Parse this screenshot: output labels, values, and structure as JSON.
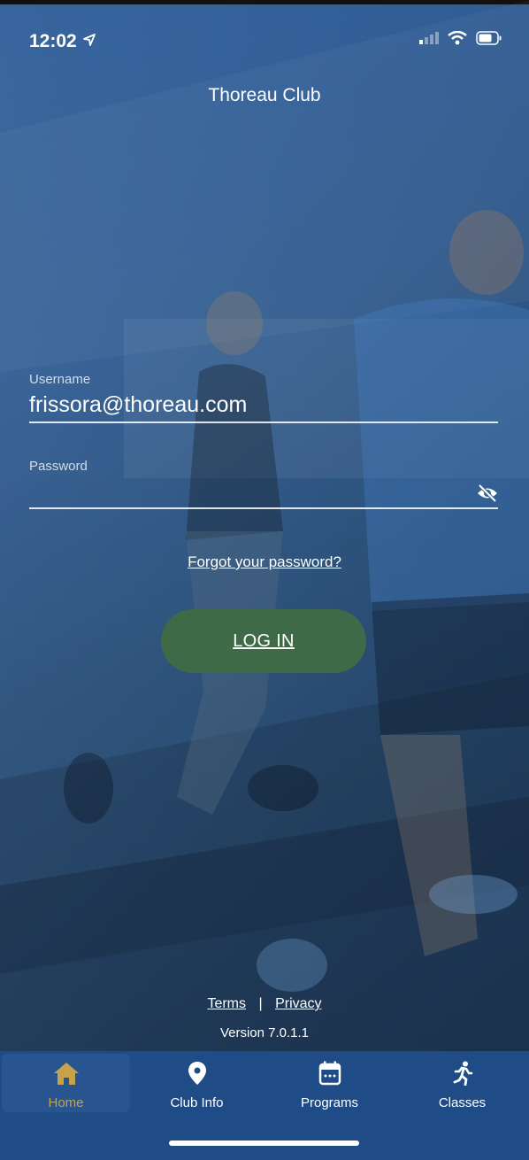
{
  "status_bar": {
    "time": "12:02"
  },
  "header": {
    "title": "Thoreau Club"
  },
  "login_form": {
    "username_label": "Username",
    "username_value": "frissora@thoreau.com",
    "password_label": "Password",
    "password_value": "",
    "forgot_link": "Forgot your password?",
    "login_button": "LOG IN"
  },
  "footer": {
    "terms": "Terms",
    "separator": "|",
    "privacy": "Privacy",
    "version": "Version 7.0.1.1"
  },
  "tab_bar": {
    "tabs": [
      {
        "label": "Home",
        "icon": "home-icon",
        "active": true
      },
      {
        "label": "Club Info",
        "icon": "map-pin-icon",
        "active": false
      },
      {
        "label": "Programs",
        "icon": "calendar-icon",
        "active": false
      },
      {
        "label": "Classes",
        "icon": "runner-icon",
        "active": false
      }
    ]
  },
  "colors": {
    "login_button": "#3f6a47",
    "tab_bar": "#1f4b86",
    "active_tab_label": "#c8a24a"
  }
}
